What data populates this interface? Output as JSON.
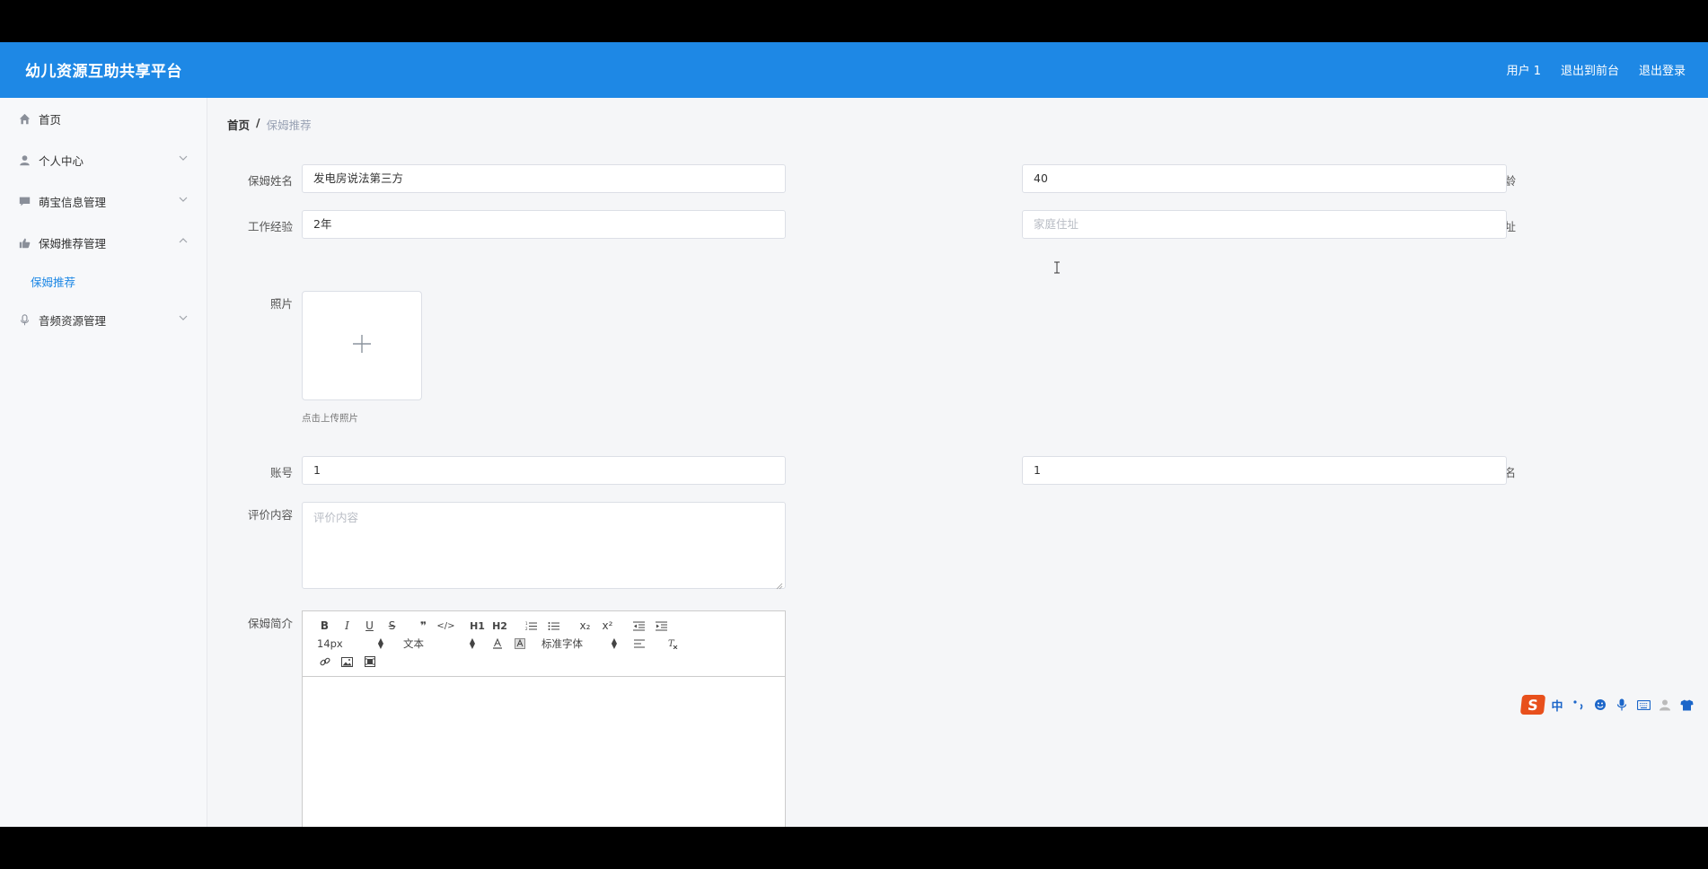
{
  "header": {
    "app_title": "幼儿资源互助共享平台",
    "user_label": "用户 1",
    "to_front_label": "退出到前台",
    "logout_label": "退出登录"
  },
  "sidebar": {
    "items": [
      {
        "label": "首页",
        "icon": "home-icon"
      },
      {
        "label": "个人中心",
        "icon": "user-icon"
      },
      {
        "label": "萌宝信息管理",
        "icon": "comment-icon"
      },
      {
        "label": "保姆推荐管理",
        "icon": "thumbs-up-icon"
      },
      {
        "label": "音频资源管理",
        "icon": "microphone-icon"
      }
    ],
    "subitem": {
      "label": "保姆推荐"
    }
  },
  "breadcrumb": {
    "home": "首页",
    "separator": "/",
    "current": "保姆推荐"
  },
  "form": {
    "nanny_name_label": "保姆姓名",
    "nanny_name_value": "发电房说法第三方",
    "age_label": "年龄",
    "age_value": "40",
    "experience_label": "工作经验",
    "experience_value": "2年",
    "address_label": "家庭住址",
    "address_placeholder": "家庭住址",
    "photo_label": "照片",
    "photo_hint": "点击上传照片",
    "account_label": "账号",
    "account_value": "1",
    "name_label": "姓名",
    "name_value": "1",
    "review_label": "评价内容",
    "review_placeholder": "评价内容",
    "intro_label": "保姆简介"
  },
  "editor": {
    "row1": [
      "B",
      "I",
      "U",
      "S",
      "❞",
      "</>",
      "H1",
      "H2",
      "ol",
      "ul",
      "x₂",
      "x²",
      "outdent",
      "indent"
    ],
    "font_size": "14px",
    "header_select": "文本",
    "font_family": "标准字体"
  },
  "ime": {
    "logo": "S",
    "lang": "中"
  }
}
